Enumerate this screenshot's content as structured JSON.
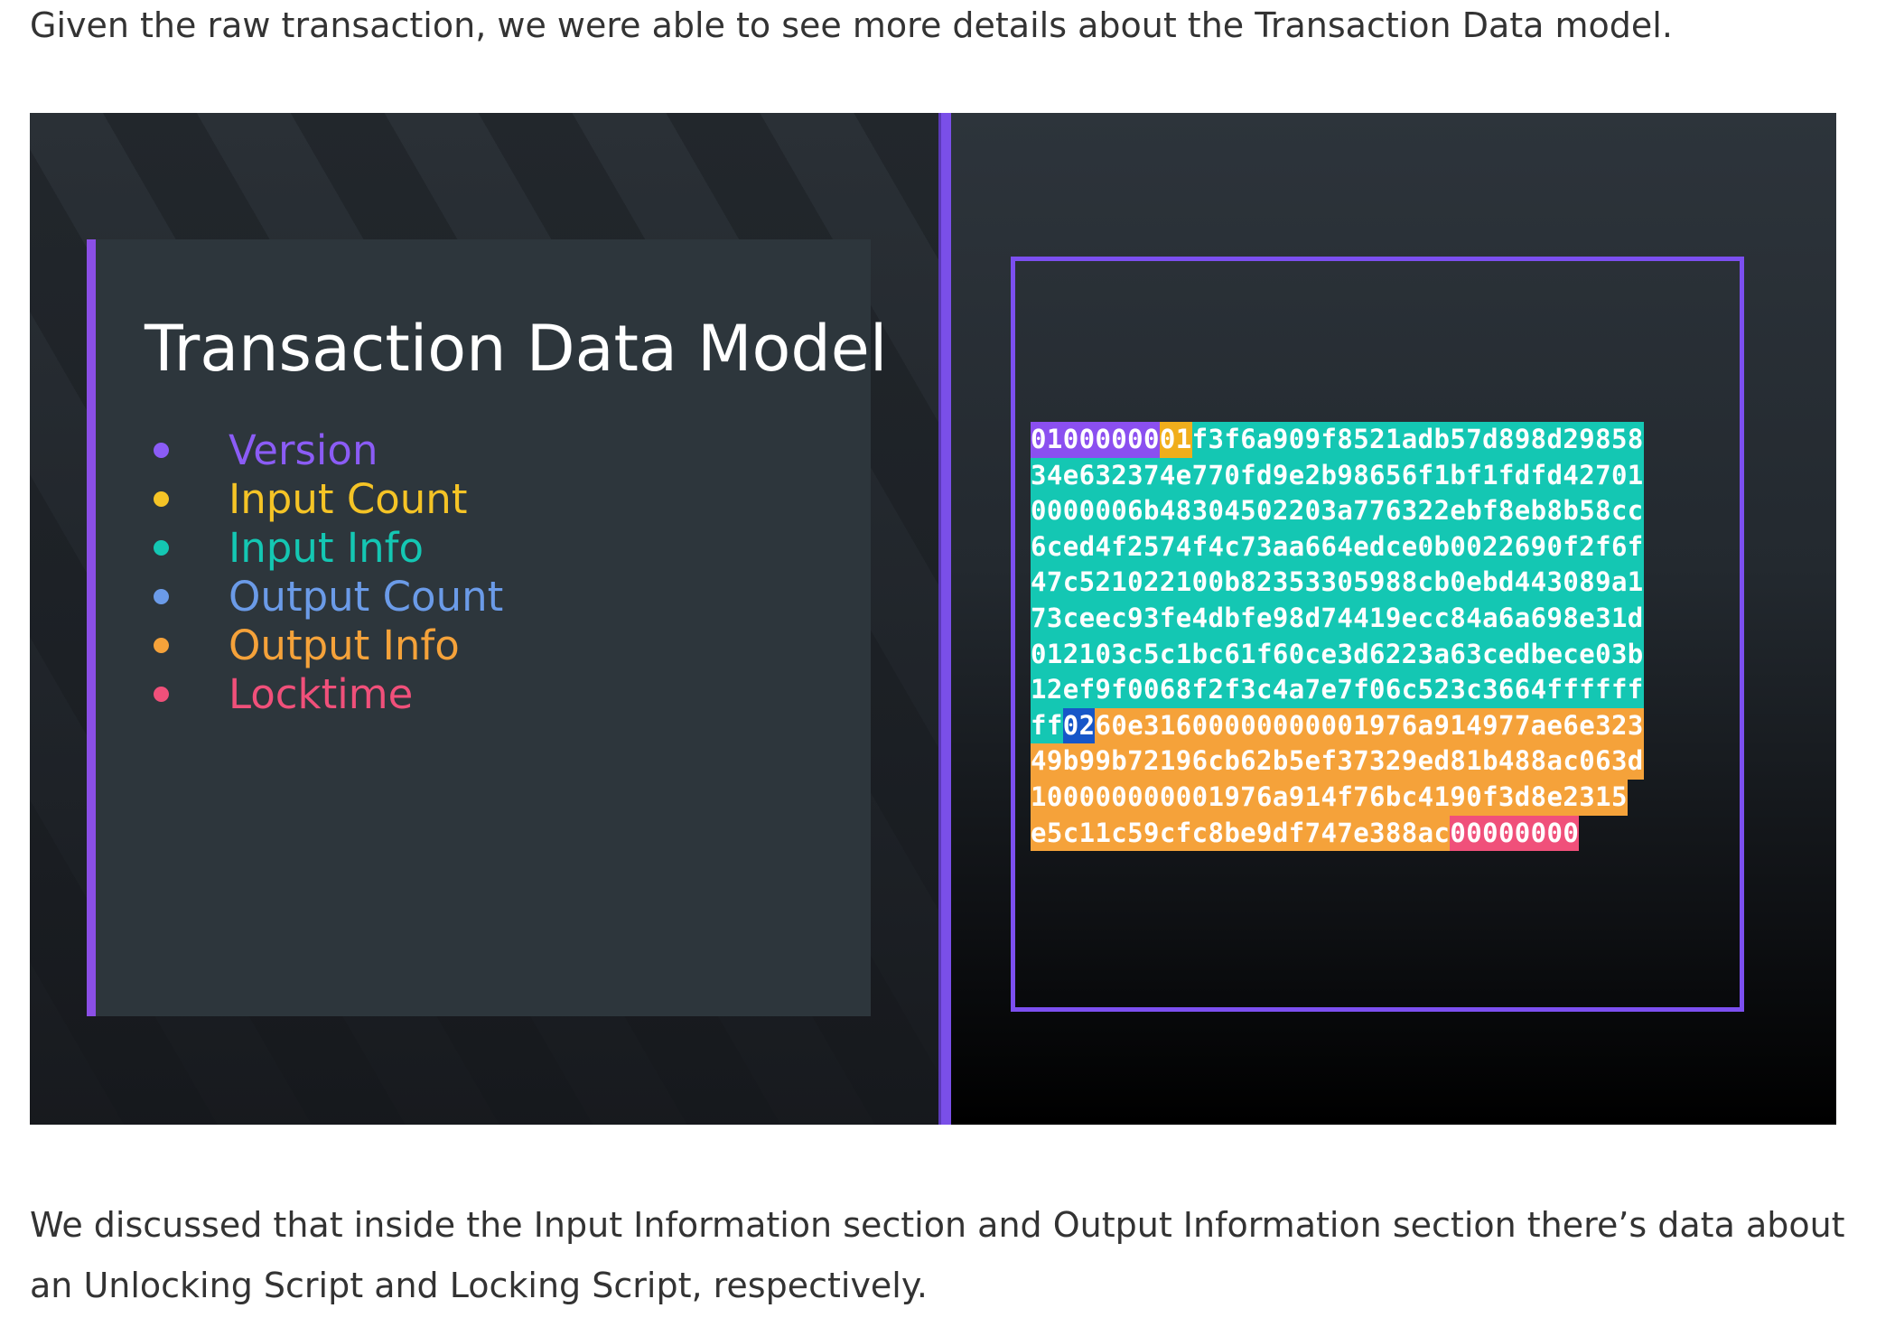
{
  "article": {
    "intro_text": "Given the raw transaction, we were able to see more details about the Transaction Data model.",
    "outro_text": "We discussed that inside the Input Information section and Output Information section there’s data about an Unlocking Script and Locking Script, respectively."
  },
  "figure": {
    "title": "Transaction Data Model",
    "legend": [
      {
        "label": "Version",
        "color": "#8b5cf6"
      },
      {
        "label": "Input Count",
        "color": "#f5c426"
      },
      {
        "label": "Input Info",
        "color": "#14c7b3"
      },
      {
        "label": "Output Count",
        "color": "#6b9be8"
      },
      {
        "label": "Output Info",
        "color": "#f5a23a"
      },
      {
        "label": "Locktime",
        "color": "#f0507a"
      }
    ],
    "accent_color": "#7c4ff0",
    "hex_lines": [
      [
        {
          "text": "01000000",
          "bg": "#8b4ff0"
        },
        {
          "text": "01",
          "bg": "#f0ae1c"
        },
        {
          "text": "f3f6a909f8521adb57d898d29858",
          "bg": "#14c7b3"
        }
      ],
      [
        {
          "text": "34e632374e770fd9e2b98656f1bf1fdfd42701",
          "bg": "#14c7b3"
        }
      ],
      [
        {
          "text": "0000006b48304502203a776322ebf8eb8b58cc",
          "bg": "#14c7b3"
        }
      ],
      [
        {
          "text": "6ced4f2574f4c73aa664edce0b0022690f2f6f",
          "bg": "#14c7b3"
        }
      ],
      [
        {
          "text": "47c521022100b82353305988cb0ebd443089a1",
          "bg": "#14c7b3"
        }
      ],
      [
        {
          "text": "73ceec93fe4dbfe98d74419ecc84a6a698e31d",
          "bg": "#14c7b3"
        }
      ],
      [
        {
          "text": "012103c5c1bc61f60ce3d6223a63cedbece03b",
          "bg": "#14c7b3"
        }
      ],
      [
        {
          "text": "12ef9f0068f2f3c4a7e7f06c523c3664ffffff",
          "bg": "#14c7b3"
        }
      ],
      [
        {
          "text": "ff",
          "bg": "#14c7b3"
        },
        {
          "text": "02",
          "bg": "#1656c8"
        },
        {
          "text": "60e31600000000001976a914977ae6e323",
          "bg": "#f5a23a"
        }
      ],
      [
        {
          "text": "49b99b72196cb62b5ef37329ed81b488ac063d",
          "bg": "#f5a23a"
        }
      ],
      [
        {
          "text": "100000000001976a914f76bc4190f3d8e2315",
          "bg": "#f5a23a"
        }
      ],
      [
        {
          "text": "e5c11c59cfc8be9df747e388ac",
          "bg": "#f5a23a"
        },
        {
          "text": "00000000",
          "bg": "#f0507a"
        }
      ]
    ]
  }
}
